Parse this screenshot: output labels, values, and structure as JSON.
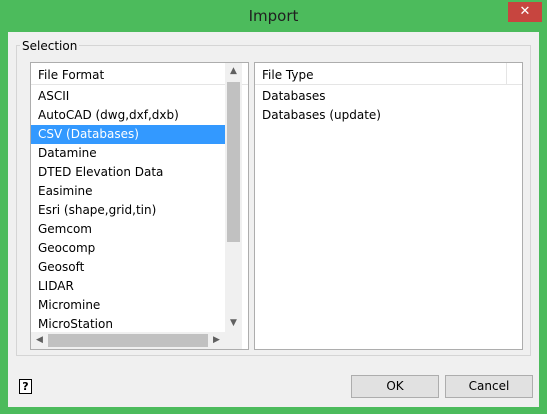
{
  "window": {
    "title": "Import",
    "close_glyph": "✕"
  },
  "group": {
    "label": "Selection"
  },
  "formats": {
    "header": "File Format",
    "items": [
      "ASCII",
      "AutoCAD (dwg,dxf,dxb)",
      "CSV (Databases)",
      "Datamine",
      "DTED Elevation Data",
      "Easimine",
      "Esri (shape,grid,tin)",
      "Gemcom",
      "Geocomp",
      "Geosoft",
      "LIDAR",
      "Micromine",
      "MicroStation"
    ],
    "selected_index": 2
  },
  "types": {
    "header": "File Type",
    "items": [
      "Databases",
      "Databases (update)"
    ]
  },
  "buttons": {
    "ok": "OK",
    "cancel": "Cancel"
  },
  "help": {
    "glyph": "?"
  },
  "colors": {
    "titlebar": "#4cbb5c",
    "close": "#c7453f",
    "selection": "#3399ff"
  }
}
